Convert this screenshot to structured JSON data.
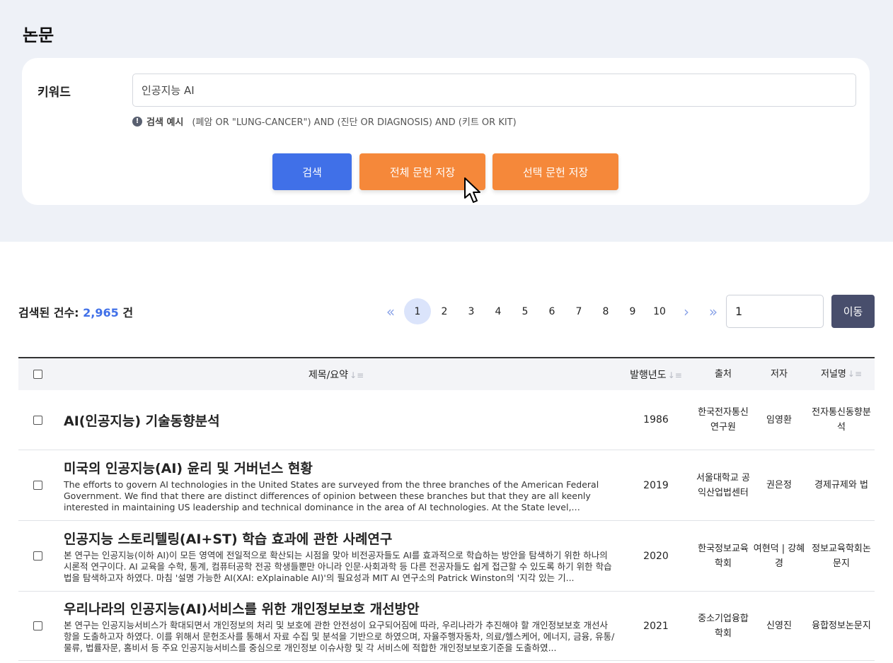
{
  "page": {
    "title": "논문"
  },
  "search": {
    "keyword_label": "키워드",
    "keyword_value": "인공지능 AI",
    "info_icon": "info-circle-icon",
    "example_label": "검색 예시",
    "example_text": "(폐암 OR \"LUNG-CANCER\") AND (진단 OR DIAGNOSIS) AND (키트 OR KIT)",
    "search_button": "검색",
    "save_all_button": "전체 문헌 저장",
    "save_selected_button": "선택 문헌 저장"
  },
  "results": {
    "count_label": "검색된 건수:",
    "count_value": "2,965",
    "count_unit": "건"
  },
  "pagination": {
    "first": "«",
    "prev": "‹",
    "next": "›",
    "last": "»",
    "pages": [
      "1",
      "2",
      "3",
      "4",
      "5",
      "6",
      "7",
      "8",
      "9",
      "10"
    ],
    "current": "1",
    "goto_value": "1",
    "goto_button": "이동"
  },
  "table": {
    "headers": {
      "title": "제목/요약",
      "year": "발행년도",
      "source": "출처",
      "author": "저자",
      "journal": "저널명"
    },
    "sort_icon": "sort-icon",
    "rows": [
      {
        "title": "AI(인공지능) 기술동향분석",
        "abstract": "",
        "year": "1986",
        "source": "한국전자통신연구원",
        "author": "임영환",
        "journal": "전자통신동향분석"
      },
      {
        "title": "미국의 인공지능(AI) 윤리 및 거버넌스 현황",
        "abstract": "The efforts to govern AI technologies in the United States are surveyed from the three branches of the American Federal Government. We find that there are distinct differences of opinion between these branches but that they are all keenly interested in maintaining US leadership and technical dominance in the area of AI technologies. At the State level, California i...",
        "year": "2019",
        "source": "서울대학교 공익산업법센터",
        "author": "권은정",
        "journal": "경제규제와 법"
      },
      {
        "title": "인공지능 스토리텔링(AI+ST) 학습 효과에 관한 사례연구",
        "abstract": "본 연구는 인공지능(이하 AI)이 모든 영역에 전일적으로 확산되는 시점을 맞아 비전공자들도 AI를 효과적으로 학습하는 방안을 탐색하기 위한 하나의 시론적 연구이다. AI 교육을 수학, 통계, 컴퓨터공학 전공 학생들뿐만 아니라 인문·사회과학 등 다른 전공자들도 쉽게 접근할 수 있도록 하기 위한 학습법을 탐색하고자 하였다. 마침 '설명 가능한 AI(XAI: eXplainable AI)'의 필요성과 MIT AI 연구소의 Patrick Winston의 '지각 있는 기...",
        "year": "2020",
        "source": "한국정보교육학회",
        "author": "여현덕 | 강혜경",
        "journal": "정보교육학회논문지"
      },
      {
        "title": "우리나라의 인공지능(AI)서비스를 위한 개인정보보호 개선방안",
        "abstract": "본 연구는 인공지능서비스가 확대되면서 개인정보의 처리 및 보호에 관한 안전성이 요구되어짐에 따라, 우리나라가 추진해야 할 개인정보보호 개선사항을 도출하고자 하였다. 이를 위해서 문헌조사를 통해서 자료 수집 및 분석을 기반으로 하였으며, 자율주행자동차, 의료/헬스케어, 에너지, 금융, 유통/물류, 법률자문, 홈비서 등 주요 인공지능서비스를 중심으로 개인정보 이슈사항 및 각 서비스에 적합한 개인정보보호기준을 도출하였...",
        "year": "2021",
        "source": "중소기업융합학회",
        "author": "신영진",
        "journal": "융합정보논문지"
      }
    ]
  },
  "colors": {
    "primary": "#4070e8",
    "orange": "#f5883a",
    "dark": "#484e6c",
    "bg": "#eef1f7"
  }
}
